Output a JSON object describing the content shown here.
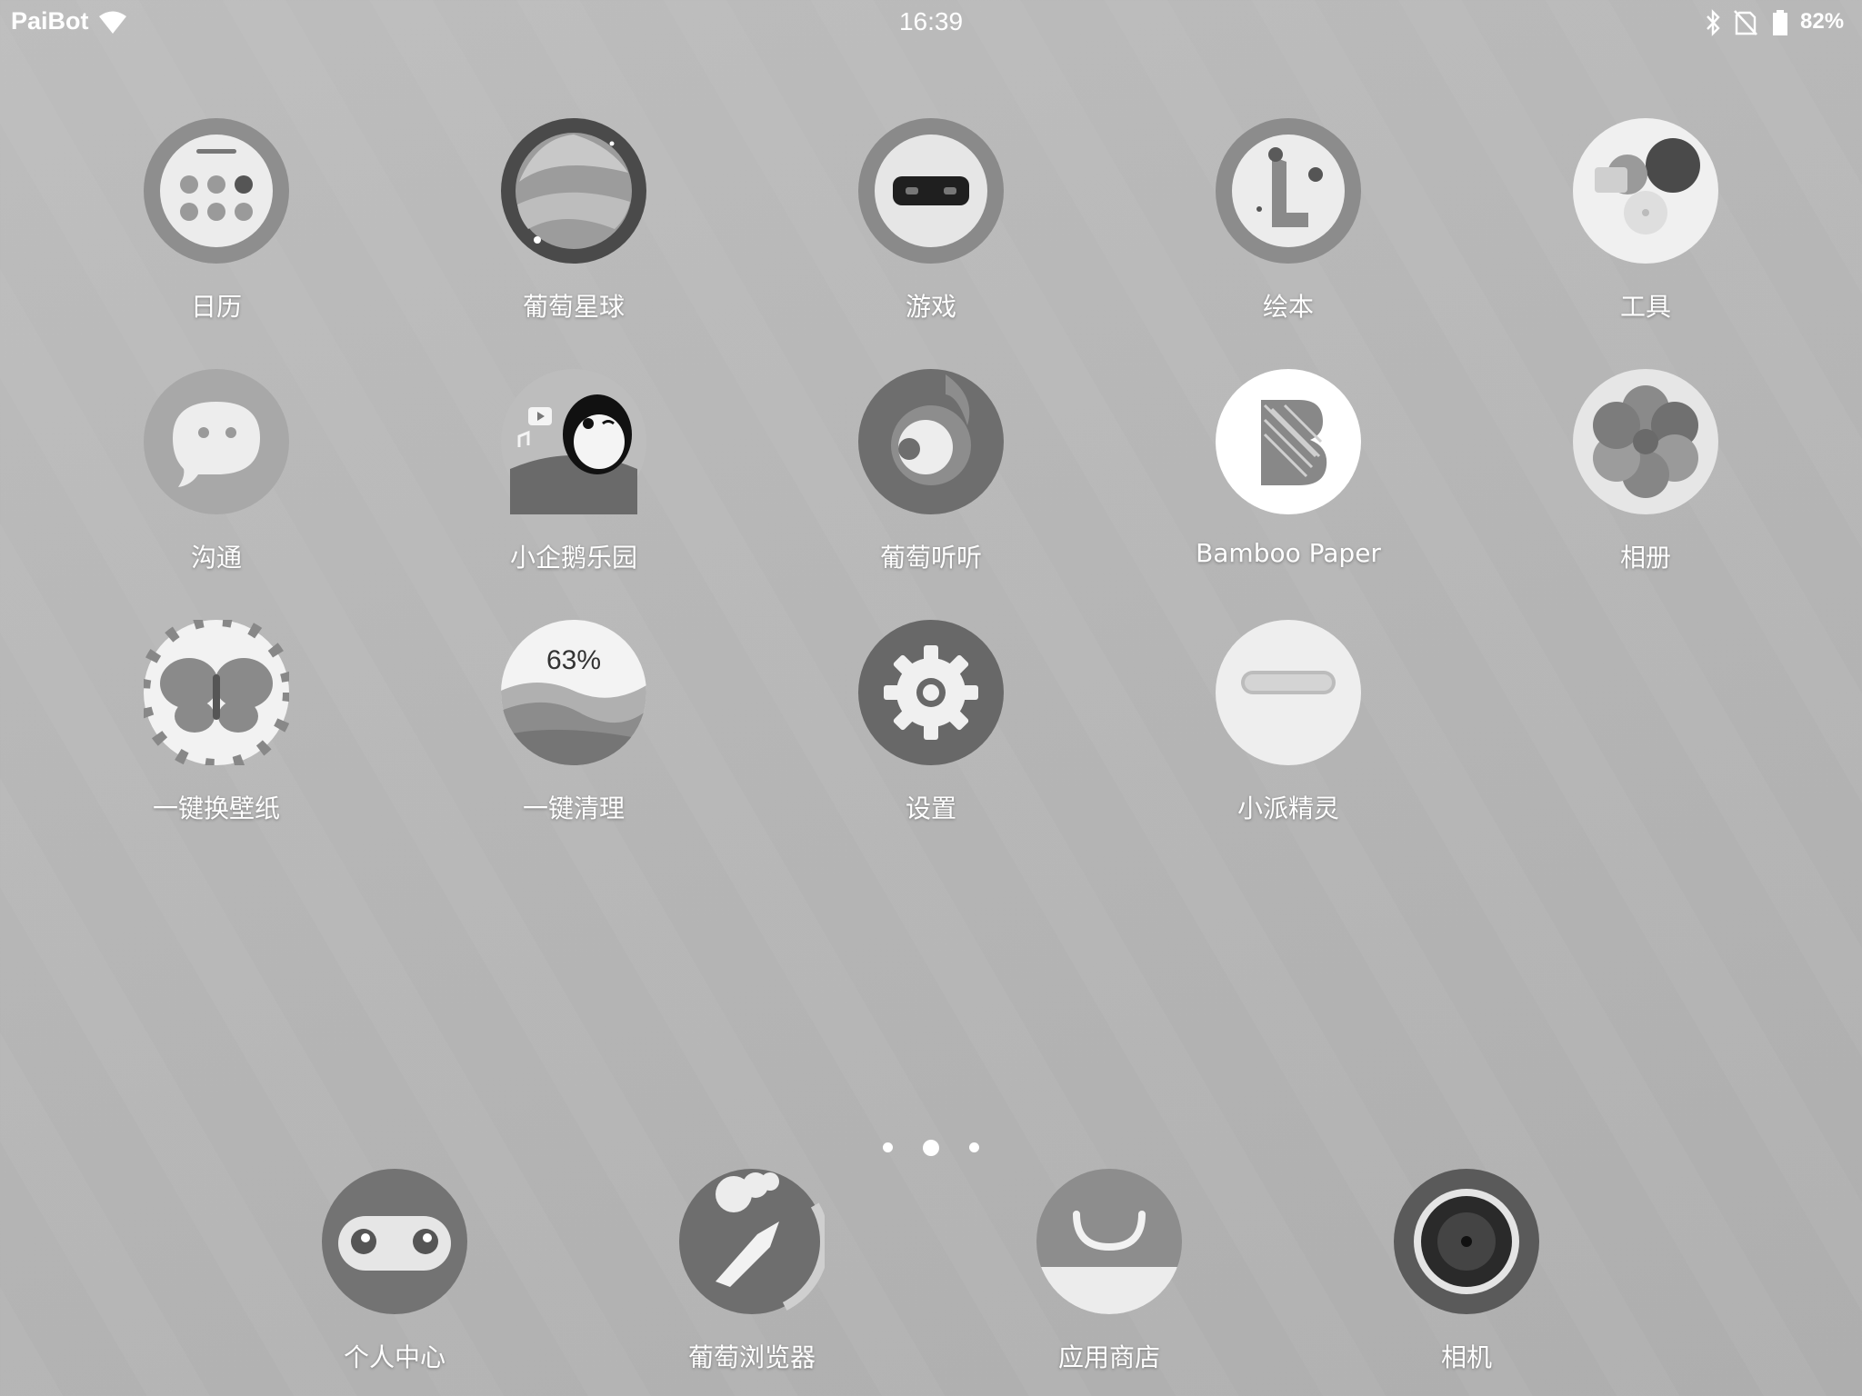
{
  "status_bar": {
    "carrier": "PaiBot",
    "time": "16:39",
    "battery_percent": "82%",
    "icons": [
      "wifi-icon",
      "bluetooth-icon",
      "no-sim-icon",
      "battery-icon"
    ]
  },
  "apps": [
    {
      "label": "日历",
      "icon": "calendar-icon"
    },
    {
      "label": "葡萄星球",
      "icon": "planet-icon"
    },
    {
      "label": "游戏",
      "icon": "game-robot-icon"
    },
    {
      "label": "绘本",
      "icon": "picture-book-icon"
    },
    {
      "label": "工具",
      "icon": "tools-icon"
    },
    {
      "label": "沟通",
      "icon": "chat-icon"
    },
    {
      "label": "小企鹅乐园",
      "icon": "penguin-icon"
    },
    {
      "label": "葡萄听听",
      "icon": "music-note-icon"
    },
    {
      "label": "Bamboo Paper",
      "icon": "bamboo-paper-icon"
    },
    {
      "label": "相册",
      "icon": "photos-icon"
    },
    {
      "label": "一键换壁纸",
      "icon": "butterfly-wallpaper-icon"
    },
    {
      "label": "一键清理",
      "icon": "cleaner-icon",
      "badge": "63%"
    },
    {
      "label": "设置",
      "icon": "gear-icon"
    },
    {
      "label": "小派精灵",
      "icon": "sprite-icon"
    }
  ],
  "pager": {
    "pages": 3,
    "current": 2
  },
  "dock": [
    {
      "label": "个人中心",
      "icon": "profile-robot-icon"
    },
    {
      "label": "葡萄浏览器",
      "icon": "browser-icon"
    },
    {
      "label": "应用商店",
      "icon": "app-store-icon"
    },
    {
      "label": "相机",
      "icon": "camera-icon"
    }
  ]
}
